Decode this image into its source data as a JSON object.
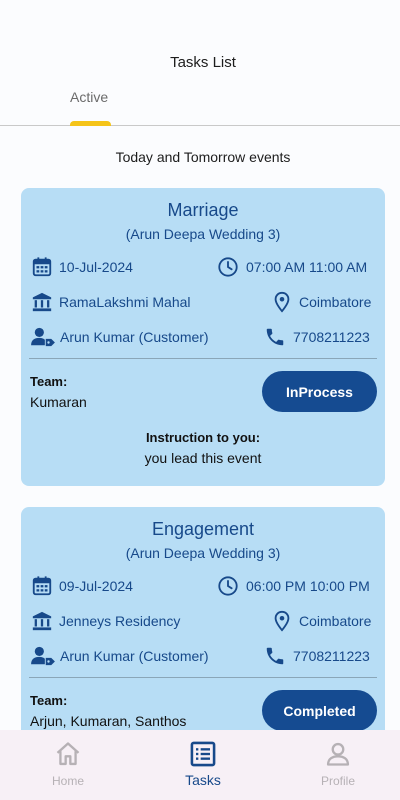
{
  "header": {
    "title": "Tasks List",
    "tabs": [
      {
        "label": "Active",
        "selected": true
      }
    ]
  },
  "section_heading": "Today and Tomorrow events",
  "events": [
    {
      "title": "Marriage",
      "subtitle": "(Arun Deepa Wedding 3)",
      "date": "10-Jul-2024",
      "time": "07:00 AM 11:00 AM",
      "venue": "RamaLakshmi Mahal",
      "city": "Coimbatore",
      "customer": "Arun Kumar (Customer)",
      "phone": "7708211223",
      "team_label": "Team:",
      "team": "Kumaran",
      "status": "InProcess",
      "instruction_label": "Instruction to you:",
      "instruction": "you lead this event"
    },
    {
      "title": "Engagement",
      "subtitle": "(Arun Deepa Wedding 3)",
      "date": "09-Jul-2024",
      "time": "06:00 PM 10:00 PM",
      "venue": "Jenneys Residency",
      "city": "Coimbatore",
      "customer": "Arun Kumar (Customer)",
      "phone": "7708211223",
      "team_label": "Team:",
      "team": "Arjun, Kumaran, Santhos",
      "status": "Completed"
    }
  ],
  "bottom_nav": [
    {
      "label": "Home",
      "icon": "home-icon",
      "active": false
    },
    {
      "label": "Tasks",
      "icon": "list-icon",
      "active": true
    },
    {
      "label": "Profile",
      "icon": "person-icon",
      "active": false
    }
  ],
  "colors": {
    "card_bg": "#b7ddf5",
    "primary": "#17498a",
    "button_bg": "#154b91",
    "tab_indicator": "#f5c419",
    "nav_bg": "#f7f0f6"
  }
}
